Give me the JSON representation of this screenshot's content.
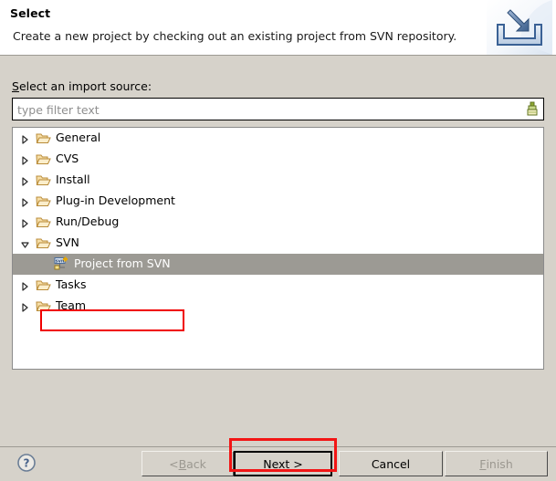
{
  "header": {
    "title": "Select",
    "description": "Create a new project by checking out an existing project from SVN repository.",
    "icon": "import-wizard-icon"
  },
  "body": {
    "source_label_prefix": "S",
    "source_label_rest": "elect an import source:",
    "filter": {
      "placeholder": "type filter text",
      "value": "",
      "clear_icon": "clear-filter-icon"
    },
    "tree": {
      "items": [
        {
          "label": "General",
          "expanded": false,
          "icon": "folder-icon",
          "selected": false,
          "level": 0
        },
        {
          "label": "CVS",
          "expanded": false,
          "icon": "folder-icon",
          "selected": false,
          "level": 0
        },
        {
          "label": "Install",
          "expanded": false,
          "icon": "folder-icon",
          "selected": false,
          "level": 0
        },
        {
          "label": "Plug-in Development",
          "expanded": false,
          "icon": "folder-icon",
          "selected": false,
          "level": 0
        },
        {
          "label": "Run/Debug",
          "expanded": false,
          "icon": "folder-icon",
          "selected": false,
          "level": 0
        },
        {
          "label": "SVN",
          "expanded": true,
          "icon": "folder-icon",
          "selected": false,
          "level": 0
        },
        {
          "label": "Project from SVN",
          "expanded": null,
          "icon": "svn-project-icon",
          "selected": true,
          "level": 1
        },
        {
          "label": "Tasks",
          "expanded": false,
          "icon": "folder-icon",
          "selected": false,
          "level": 0
        },
        {
          "label": "Team",
          "expanded": false,
          "icon": "folder-icon",
          "selected": false,
          "level": 0
        }
      ]
    }
  },
  "footer": {
    "help_icon": "help-icon",
    "buttons": [
      {
        "id": "back",
        "label_prefix": "< ",
        "label_mnemonic": "B",
        "label_rest": "ack",
        "enabled": false,
        "default": false
      },
      {
        "id": "next",
        "label_prefix": "",
        "label_mnemonic": "N",
        "label_rest": "ext >",
        "enabled": true,
        "default": true
      },
      {
        "id": "cancel",
        "label_prefix": "",
        "label_mnemonic": "",
        "label_rest": "Cancel",
        "enabled": true,
        "default": false
      },
      {
        "id": "finish",
        "label_prefix": "",
        "label_mnemonic": "F",
        "label_rest": "inish",
        "enabled": false,
        "default": false
      }
    ]
  },
  "annotations": {
    "selection_highlight_color": "#f00000",
    "next_button_highlight_color": "#f21515"
  },
  "colors": {
    "dialog_background": "#d6d2ca",
    "header_background": "#ffffff",
    "tree_background": "#ffffff",
    "selection_background": "#9c9a94",
    "folder_fill": "#f5d9a0",
    "folder_stroke": "#b08a3e"
  }
}
